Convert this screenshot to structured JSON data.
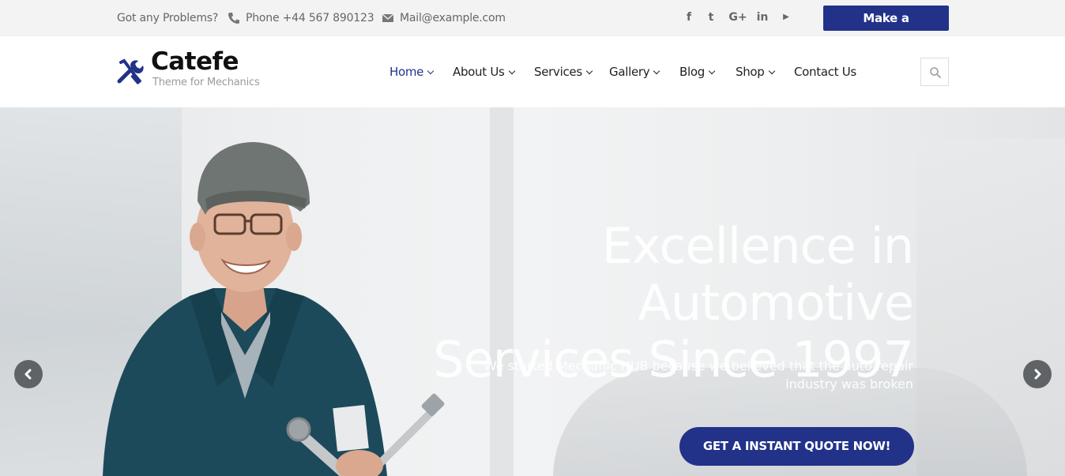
{
  "topbar": {
    "problems": "Got any Problems?",
    "phone": "Phone +44 567 890123",
    "email": "Mail@example.com",
    "appointment_label": "Make a Appoinment",
    "social_icons": [
      "facebook-icon",
      "twitter-icon",
      "google-plus-icon",
      "linkedin-icon",
      "youtube-icon"
    ],
    "social_glyphs": [
      "f",
      "t",
      "G+",
      "in",
      "▶"
    ]
  },
  "brand": {
    "name": "Catefe",
    "tagline": "Theme for Mechanics"
  },
  "nav": {
    "items": [
      {
        "label": "Home",
        "active": true
      },
      {
        "label": "About Us"
      },
      {
        "label": "Services"
      },
      {
        "label": "Gallery"
      },
      {
        "label": "Blog"
      },
      {
        "label": "Shop"
      },
      {
        "label": "Contact Us"
      }
    ]
  },
  "hero": {
    "title_line1": "Excellence in Automotive",
    "title_line2": "Services Since 1997",
    "subtitle_line1": "We started Mechanic HUB because we believed that the auto repair",
    "subtitle_line2": "industry was broken",
    "cta_label": "GET A INSTANT QUOTE NOW!"
  },
  "colors": {
    "accent": "#223289",
    "topbar_bg": "#f3f3f3",
    "arrow_bg": "#5f6366"
  }
}
